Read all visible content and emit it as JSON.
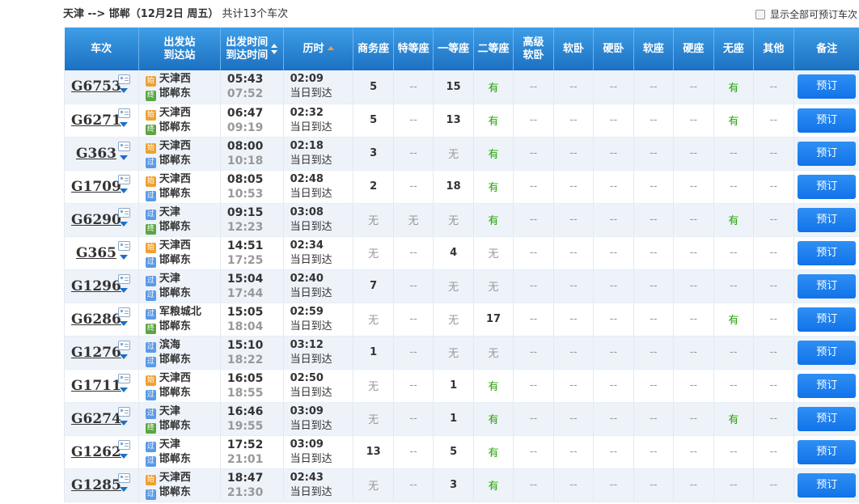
{
  "header": {
    "route": "天津 --> 邯郸（12月2日  周五）",
    "summary": "共计13个车次",
    "show_all_label": "显示全部可预订车次"
  },
  "columns": {
    "train": "车次",
    "stations_line1": "出发站",
    "stations_line2": "到达站",
    "times_line1": "出发时间",
    "times_line2": "到达时间",
    "duration": "历时",
    "seats": [
      "商务座",
      "特等座",
      "一等座",
      "二等座",
      "高级\n软卧",
      "软卧",
      "硬卧",
      "软座",
      "硬座",
      "无座",
      "其他"
    ],
    "remark": "备注"
  },
  "book_label": "预订",
  "badges": {
    "start": "始",
    "pass": "过",
    "end": "终"
  },
  "trains": [
    {
      "no": "G6753",
      "from": "天津西",
      "from_type": "start",
      "to": "邯郸东",
      "to_type": "end",
      "dep": "05:43",
      "arr": "07:52",
      "dur": "02:09",
      "note": "当日到达",
      "seats": [
        "5",
        "--",
        "15",
        "有",
        "--",
        "--",
        "--",
        "--",
        "--",
        "有",
        "--"
      ]
    },
    {
      "no": "G6271",
      "from": "天津西",
      "from_type": "start",
      "to": "邯郸东",
      "to_type": "end",
      "dep": "06:47",
      "arr": "09:19",
      "dur": "02:32",
      "note": "当日到达",
      "seats": [
        "5",
        "--",
        "13",
        "有",
        "--",
        "--",
        "--",
        "--",
        "--",
        "有",
        "--"
      ]
    },
    {
      "no": "G363",
      "from": "天津西",
      "from_type": "start",
      "to": "邯郸东",
      "to_type": "pass",
      "dep": "08:00",
      "arr": "10:18",
      "dur": "02:18",
      "note": "当日到达",
      "seats": [
        "3",
        "--",
        "无",
        "有",
        "--",
        "--",
        "--",
        "--",
        "--",
        "--",
        "--"
      ]
    },
    {
      "no": "G1709",
      "from": "天津西",
      "from_type": "start",
      "to": "邯郸东",
      "to_type": "pass",
      "dep": "08:05",
      "arr": "10:53",
      "dur": "02:48",
      "note": "当日到达",
      "seats": [
        "2",
        "--",
        "18",
        "有",
        "--",
        "--",
        "--",
        "--",
        "--",
        "--",
        "--"
      ]
    },
    {
      "no": "G6290",
      "from": "天津",
      "from_type": "pass",
      "to": "邯郸东",
      "to_type": "end",
      "dep": "09:15",
      "arr": "12:23",
      "dur": "03:08",
      "note": "当日到达",
      "seats": [
        "无",
        "无",
        "无",
        "有",
        "--",
        "--",
        "--",
        "--",
        "--",
        "有",
        "--"
      ]
    },
    {
      "no": "G365",
      "from": "天津西",
      "from_type": "start",
      "to": "邯郸东",
      "to_type": "pass",
      "dep": "14:51",
      "arr": "17:25",
      "dur": "02:34",
      "note": "当日到达",
      "seats": [
        "无",
        "--",
        "4",
        "无",
        "--",
        "--",
        "--",
        "--",
        "--",
        "--",
        "--"
      ]
    },
    {
      "no": "G1296",
      "from": "天津",
      "from_type": "pass",
      "to": "邯郸东",
      "to_type": "pass",
      "dep": "15:04",
      "arr": "17:44",
      "dur": "02:40",
      "note": "当日到达",
      "seats": [
        "7",
        "--",
        "无",
        "无",
        "--",
        "--",
        "--",
        "--",
        "--",
        "--",
        "--"
      ]
    },
    {
      "no": "G6286",
      "from": "军粮城北",
      "from_type": "pass",
      "to": "邯郸东",
      "to_type": "end",
      "dep": "15:05",
      "arr": "18:04",
      "dur": "02:59",
      "note": "当日到达",
      "seats": [
        "无",
        "--",
        "无",
        "17",
        "--",
        "--",
        "--",
        "--",
        "--",
        "有",
        "--"
      ]
    },
    {
      "no": "G1276",
      "from": "滨海",
      "from_type": "pass",
      "to": "邯郸东",
      "to_type": "pass",
      "dep": "15:10",
      "arr": "18:22",
      "dur": "03:12",
      "note": "当日到达",
      "seats": [
        "1",
        "--",
        "无",
        "无",
        "--",
        "--",
        "--",
        "--",
        "--",
        "--",
        "--"
      ]
    },
    {
      "no": "G1711",
      "from": "天津西",
      "from_type": "start",
      "to": "邯郸东",
      "to_type": "pass",
      "dep": "16:05",
      "arr": "18:55",
      "dur": "02:50",
      "note": "当日到达",
      "seats": [
        "无",
        "--",
        "1",
        "有",
        "--",
        "--",
        "--",
        "--",
        "--",
        "--",
        "--"
      ]
    },
    {
      "no": "G6274",
      "from": "天津",
      "from_type": "pass",
      "to": "邯郸东",
      "to_type": "end",
      "dep": "16:46",
      "arr": "19:55",
      "dur": "03:09",
      "note": "当日到达",
      "seats": [
        "无",
        "--",
        "1",
        "有",
        "--",
        "--",
        "--",
        "--",
        "--",
        "有",
        "--"
      ]
    },
    {
      "no": "G1262",
      "from": "天津",
      "from_type": "pass",
      "to": "邯郸东",
      "to_type": "pass",
      "dep": "17:52",
      "arr": "21:01",
      "dur": "03:09",
      "note": "当日到达",
      "seats": [
        "13",
        "--",
        "5",
        "有",
        "--",
        "--",
        "--",
        "--",
        "--",
        "--",
        "--"
      ]
    },
    {
      "no": "G1285",
      "from": "天津西",
      "from_type": "start",
      "to": "邯郸东",
      "to_type": "pass",
      "dep": "18:47",
      "arr": "21:30",
      "dur": "02:43",
      "note": "当日到达",
      "seats": [
        "无",
        "--",
        "3",
        "有",
        "--",
        "--",
        "--",
        "--",
        "--",
        "--",
        "--"
      ]
    }
  ],
  "colors": {
    "header_top": "#3f9ee6",
    "header_bottom": "#1b70c2",
    "available": "#26a306",
    "button": "#1173e8",
    "row_alt": "#eef3fa"
  },
  "icons": {
    "card": "card-icon",
    "expand": "chevron-down-icon",
    "sort": "sort-icon"
  }
}
